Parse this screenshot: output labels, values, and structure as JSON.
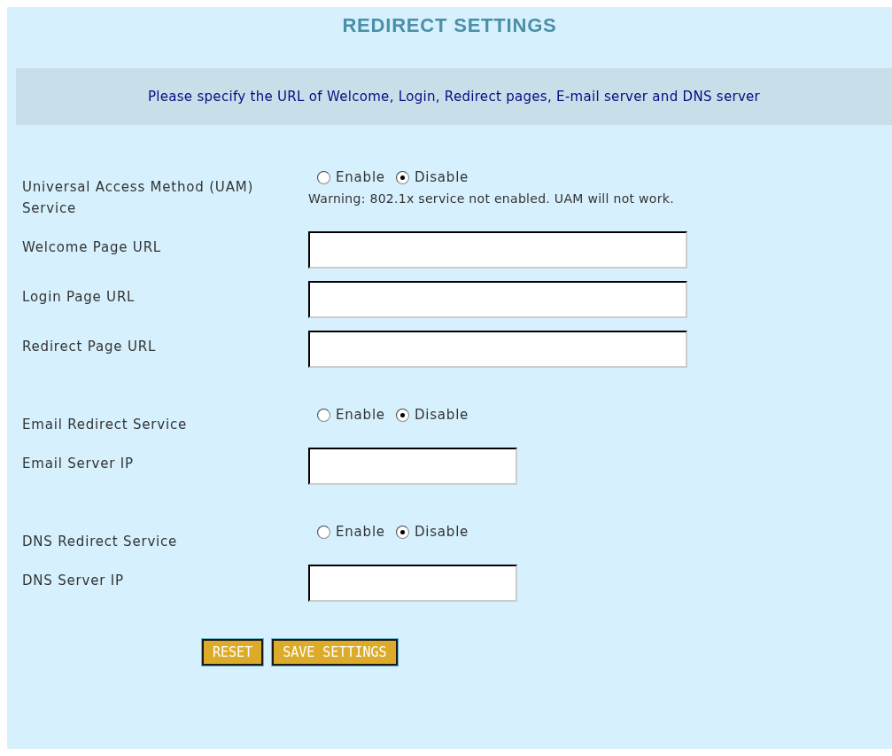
{
  "title": "REDIRECT SETTINGS",
  "info": "Please specify the URL of Welcome, Login, Redirect pages, E-mail server and DNS server",
  "groups": [
    {
      "rows": [
        {
          "kind": "radio",
          "label": "Universal Access Method (UAM) Service",
          "options": [
            {
              "label": "Enable",
              "selected": false
            },
            {
              "label": "Disable",
              "selected": true
            }
          ],
          "warning": "Warning: 802.1x service not enabled. UAM will not work."
        },
        {
          "kind": "url",
          "label": "Welcome Page URL"
        },
        {
          "kind": "url",
          "label": "Login Page URL"
        },
        {
          "kind": "url",
          "label": "Redirect Page URL"
        }
      ]
    },
    {
      "rows": [
        {
          "kind": "radio",
          "label": "Email Redirect Service",
          "options": [
            {
              "label": "Enable",
              "selected": false
            },
            {
              "label": "Disable",
              "selected": true
            }
          ]
        },
        {
          "kind": "ip",
          "label": "Email Server IP"
        }
      ]
    },
    {
      "rows": [
        {
          "kind": "radio",
          "label": "DNS Redirect Service",
          "options": [
            {
              "label": "Enable",
              "selected": false
            },
            {
              "label": "Disable",
              "selected": true
            }
          ]
        },
        {
          "kind": "ip",
          "label": "DNS Server IP"
        }
      ]
    }
  ],
  "buttons": [
    "RESET",
    "SAVE SETTINGS"
  ]
}
